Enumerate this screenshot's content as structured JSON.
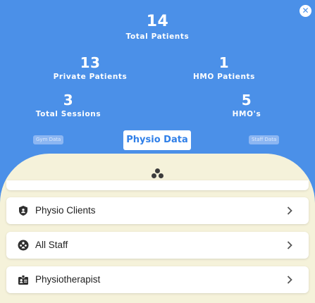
{
  "stats": {
    "total": {
      "value": "14",
      "label": "Total Patients"
    },
    "private": {
      "value": "13",
      "label": "Private Patients"
    },
    "hmo": {
      "value": "1",
      "label": "HMO Patients"
    },
    "sessions": {
      "value": "3",
      "label": "Total Sessions"
    },
    "hmos": {
      "value": "5",
      "label": "HMO's"
    }
  },
  "tabs": {
    "gym": "Gym Data",
    "physio": "Physio Data",
    "staff": "Staff Data"
  },
  "close_icon": "close-icon",
  "list": [
    {
      "label": "Physio Clients",
      "icon": "shield-icon"
    },
    {
      "label": "All Staff",
      "icon": "group-icon"
    },
    {
      "label": "Physiotherapist",
      "icon": "badge-icon"
    }
  ],
  "colors": {
    "header_bg": "#4b90e8",
    "panel_bg": "#f5f2da",
    "active_tab_text": "#2f7fe8"
  }
}
